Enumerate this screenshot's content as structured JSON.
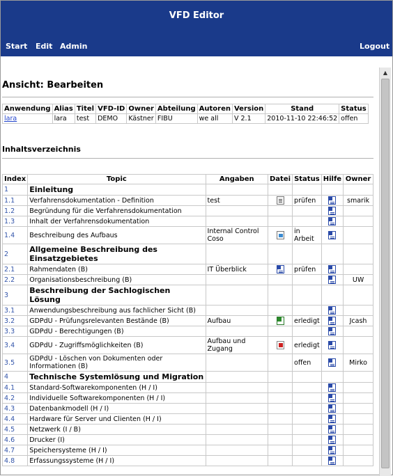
{
  "header": {
    "title": "VFD Editor",
    "nav": {
      "start": "Start",
      "edit": "Edit",
      "admin": "Admin",
      "logout": "Logout"
    }
  },
  "page": {
    "heading": "Ansicht: Bearbeiten",
    "toc_heading": "Inhaltsverzeichnis"
  },
  "meta": {
    "headers": [
      "Anwendung",
      "Alias",
      "Titel",
      "VFD-ID",
      "Owner",
      "Abteilung",
      "Autoren",
      "Version",
      "Stand",
      "Status"
    ],
    "row": [
      "lara",
      "lara",
      "test",
      "DEMO",
      "Kästner",
      "FIBU",
      "we all",
      "V 2.1",
      "2010-11-10 22:46:52",
      "offen"
    ]
  },
  "toc": {
    "headers": [
      "Index",
      "Topic",
      "Angaben",
      "Datei",
      "Status",
      "Hilfe",
      "Owner"
    ],
    "rows": [
      {
        "idx": "1",
        "topic": "Einleitung",
        "chapter": true,
        "angaben": "",
        "datei": "",
        "status": "",
        "hilfe": "",
        "owner": ""
      },
      {
        "idx": "1.1",
        "topic": "Verfahrensdokumentation - Definition",
        "angaben": "test",
        "datei": "note-icon",
        "status": "prüfen",
        "hilfe": "word-icon",
        "owner": "smarik"
      },
      {
        "idx": "1.2",
        "topic": "Begründung für die Verfahrensdokumentation",
        "angaben": "",
        "datei": "",
        "status": "",
        "hilfe": "word-icon",
        "owner": ""
      },
      {
        "idx": "1.3",
        "topic": "Inhalt der Verfahrensdokumentation",
        "angaben": "",
        "datei": "",
        "status": "",
        "hilfe": "word-icon",
        "owner": ""
      },
      {
        "idx": "1.4",
        "topic": "Beschreibung des Aufbaus",
        "angaben": "Internal Control Coso",
        "datei": "img-icon",
        "status": "in Arbeit",
        "hilfe": "word-icon",
        "owner": ""
      },
      {
        "idx": "2",
        "topic": "Allgemeine Beschreibung des Einsatzgebietes",
        "chapter": true,
        "angaben": "",
        "datei": "",
        "status": "",
        "hilfe": "",
        "owner": ""
      },
      {
        "idx": "2.1",
        "topic": "Rahmendaten (B)",
        "angaben": "IT Überblick",
        "datei": "word-icon",
        "status": "prüfen",
        "hilfe": "word-icon",
        "owner": ""
      },
      {
        "idx": "2.2",
        "topic": "Organisationsbeschreibung (B)",
        "angaben": "",
        "datei": "",
        "status": "",
        "hilfe": "word-icon",
        "owner": "UW"
      },
      {
        "idx": "3",
        "topic": "Beschreibung der Sachlogischen Lösung",
        "chapter": true,
        "angaben": "",
        "datei": "",
        "status": "",
        "hilfe": "",
        "owner": ""
      },
      {
        "idx": "3.1",
        "topic": "Anwendungsbeschreibung aus fachlicher Sicht (B)",
        "angaben": "",
        "datei": "",
        "status": "",
        "hilfe": "word-icon",
        "owner": ""
      },
      {
        "idx": "3.2",
        "topic": "GDPdU - Prüfungsrelevanten Bestände (B)",
        "angaben": "Aufbau",
        "datei": "excel-icon",
        "status": "erledigt",
        "hilfe": "word-icon",
        "owner": "Jcash"
      },
      {
        "idx": "3.3",
        "topic": "GDPdU - Berechtigungen (B)",
        "angaben": "",
        "datei": "",
        "status": "",
        "hilfe": "word-icon",
        "owner": ""
      },
      {
        "idx": "3.4",
        "topic": "GDPdU - Zugriffsmöglichkeiten (B)",
        "angaben": "Aufbau und Zugang",
        "datei": "pdf-icon",
        "status": "erledigt",
        "hilfe": "word-icon",
        "owner": ""
      },
      {
        "idx": "3.5",
        "topic": "GDPdU - Löschen von Dokumenten oder Informationen (B)",
        "angaben": "",
        "datei": "",
        "status": "offen",
        "hilfe": "word-icon",
        "owner": "Mirko"
      },
      {
        "idx": "4",
        "topic": "Technische Systemlösung und Migration",
        "chapter": true,
        "angaben": "",
        "datei": "",
        "status": "",
        "hilfe": "",
        "owner": ""
      },
      {
        "idx": "4.1",
        "topic": "Standard-Softwarekomponenten (H / I)",
        "angaben": "",
        "datei": "",
        "status": "",
        "hilfe": "word-icon",
        "owner": ""
      },
      {
        "idx": "4.2",
        "topic": "Individuelle Softwarekomponenten (H / I)",
        "angaben": "",
        "datei": "",
        "status": "",
        "hilfe": "word-icon",
        "owner": ""
      },
      {
        "idx": "4.3",
        "topic": "Datenbankmodell (H / I)",
        "angaben": "",
        "datei": "",
        "status": "",
        "hilfe": "word-icon",
        "owner": ""
      },
      {
        "idx": "4.4",
        "topic": "Hardware für Server und Clienten (H / I)",
        "angaben": "",
        "datei": "",
        "status": "",
        "hilfe": "word-icon",
        "owner": ""
      },
      {
        "idx": "4.5",
        "topic": "Netzwerk (I / B)",
        "angaben": "",
        "datei": "",
        "status": "",
        "hilfe": "word-icon",
        "owner": ""
      },
      {
        "idx": "4.6",
        "topic": "Drucker (I)",
        "angaben": "",
        "datei": "",
        "status": "",
        "hilfe": "word-icon",
        "owner": ""
      },
      {
        "idx": "4.7",
        "topic": "Speichersysteme (H / I)",
        "angaben": "",
        "datei": "",
        "status": "",
        "hilfe": "word-icon",
        "owner": ""
      },
      {
        "idx": "4.8",
        "topic": "Erfassungssysteme (H / I)",
        "angaben": "",
        "datei": "",
        "status": "",
        "hilfe": "word-icon",
        "owner": ""
      }
    ]
  }
}
